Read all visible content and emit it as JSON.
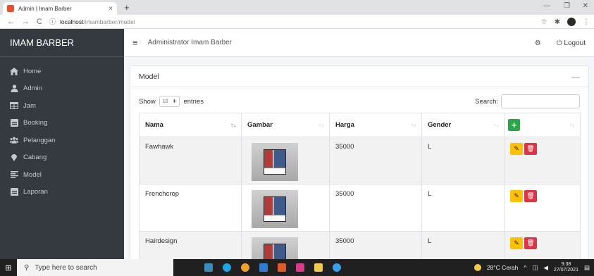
{
  "browser": {
    "tab_title": "Admin | Imam Barber",
    "tab_close": "×",
    "new_tab": "+",
    "url_host": "localhost",
    "url_path": "/imambarber/model",
    "minimize": "—",
    "maximize": "❐",
    "close": "✕",
    "back": "←",
    "forward": "→",
    "reload": "C",
    "info": "ⓘ",
    "star": "☆",
    "extensions": "✱",
    "menu_dots": "⋮"
  },
  "sidebar": {
    "brand": "IMAM BARBER",
    "items": [
      {
        "label": "Home",
        "icon": "home-icon"
      },
      {
        "label": "Admin",
        "icon": "user-icon"
      },
      {
        "label": "Jam",
        "icon": "table-icon"
      },
      {
        "label": "Booking",
        "icon": "booking-icon"
      },
      {
        "label": "Pelanggan",
        "icon": "users-icon"
      },
      {
        "label": "Cabang",
        "icon": "map-marker-icon"
      },
      {
        "label": "Model",
        "icon": "align-icon"
      },
      {
        "label": "Laporan",
        "icon": "report-icon"
      }
    ]
  },
  "navbar": {
    "user": "Administrator Imam Barber",
    "logout": "Logout"
  },
  "card": {
    "title": "Model",
    "collapse": "—"
  },
  "datatable": {
    "show_label": "Show",
    "length_value": "10",
    "entries_label": "entries",
    "search_label": "Search:",
    "columns": [
      "Nama",
      "Gambar",
      "Harga",
      "Gender"
    ],
    "add_button": "+",
    "rows": [
      {
        "nama": "Fawhawk",
        "harga": "35000",
        "gender": "L"
      },
      {
        "nama": "Frenchcrop",
        "harga": "35000",
        "gender": "L"
      },
      {
        "nama": "Hairdesign",
        "harga": "35000",
        "gender": "L"
      }
    ]
  },
  "taskbar": {
    "search_placeholder": "Type here to search",
    "weather": "28°C Cerah",
    "time": "9:38",
    "date": "27/07/2021",
    "apps": [
      "#3c8dbc",
      "#1fa4e6",
      "#f0a030",
      "#2f7bd6",
      "#e05a2a",
      "#d93a8a",
      "#f2c94c",
      "#3aa0e8"
    ]
  },
  "colors": {
    "sidebar_bg": "#343a40",
    "accent_green": "#28a745",
    "edit_yellow": "#ffc107",
    "delete_red": "#dc3545"
  }
}
